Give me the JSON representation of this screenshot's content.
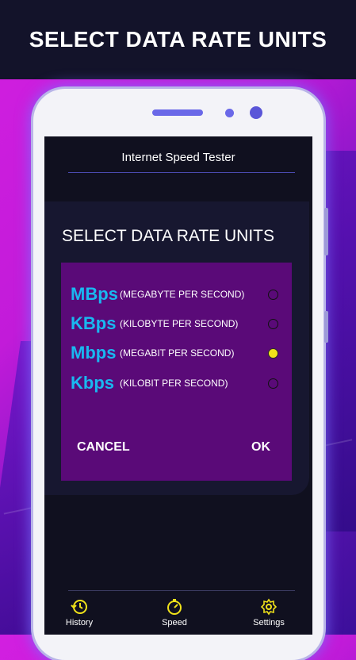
{
  "banner": {
    "title": "SELECT DATA RATE UNITS"
  },
  "app": {
    "title": "Internet Speed Tester"
  },
  "dialog": {
    "heading": "SELECT DATA RATE UNITS",
    "options": [
      {
        "unit": "MBps",
        "description": "(MEGABYTE PER SECOND)",
        "selected": false
      },
      {
        "unit": "KBps",
        "description": "(KILOBYTE PER SECOND)",
        "selected": false
      },
      {
        "unit": "Mbps",
        "description": "(MEGABIT PER SECOND)",
        "selected": true
      },
      {
        "unit": "Kbps",
        "description": "(KILOBIT PER SECOND)",
        "selected": false
      }
    ],
    "cancel_label": "CANCEL",
    "ok_label": "OK"
  },
  "nav": {
    "items": [
      {
        "label": "History",
        "icon": "history-icon"
      },
      {
        "label": "Speed",
        "icon": "speedometer-icon"
      },
      {
        "label": "Settings",
        "icon": "gear-icon"
      }
    ]
  },
  "colors": {
    "accent_unit": "#19b8f0",
    "icon_yellow": "#f0e21a",
    "dialog_body": "#5a0a78",
    "screen_bg": "#10101f"
  }
}
